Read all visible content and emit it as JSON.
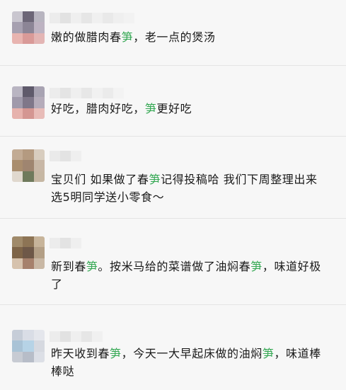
{
  "comments": [
    {
      "segments": [
        {
          "t": "嫩的做腊肉春"
        },
        {
          "t": "笋",
          "hl": true
        },
        {
          "t": "，老一点的煲汤"
        }
      ]
    },
    {
      "segments": [
        {
          "t": "好吃，腊肉好吃，"
        },
        {
          "t": "笋",
          "hl": true
        },
        {
          "t": "更好吃"
        }
      ]
    },
    {
      "segments": [
        {
          "t": "宝贝们 如果做了春"
        },
        {
          "t": "笋",
          "hl": true
        },
        {
          "t": "记得投稿哈 我们下周整理出来 选5明同学送小零食～"
        }
      ]
    },
    {
      "segments": [
        {
          "t": "新到春"
        },
        {
          "t": "笋",
          "hl": true
        },
        {
          "t": "。按米马给的菜谱做了油焖春"
        },
        {
          "t": "笋",
          "hl": true
        },
        {
          "t": "，味道好极了"
        }
      ]
    },
    {
      "segments": [
        {
          "t": "昨天收到春"
        },
        {
          "t": "笋",
          "hl": true
        },
        {
          "t": "，今天一大早起床做的油焖"
        },
        {
          "t": "笋",
          "hl": true
        },
        {
          "t": "，味道棒棒哒"
        }
      ]
    }
  ],
  "colors": {
    "highlight": "#34a853",
    "text": "#1a1a1a",
    "background": "#f7f7f7"
  }
}
